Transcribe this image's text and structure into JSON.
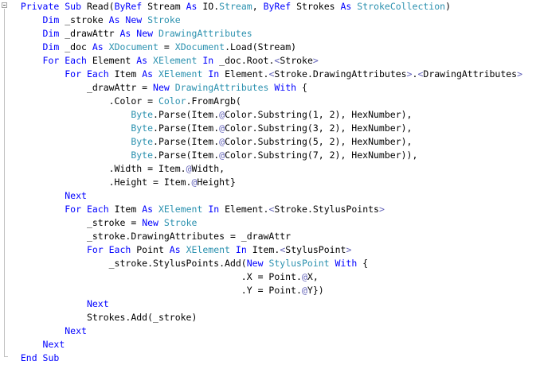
{
  "editor": {
    "language": "VB.NET",
    "colors": {
      "keyword": "#0000ff",
      "type": "#2b91af",
      "string_literal": "#a31515",
      "xml_bracket": "#6464b9",
      "plain": "#000000"
    },
    "lines": [
      {
        "indent": 2,
        "tokens": [
          [
            "kw",
            "Private Sub"
          ],
          [
            "p",
            " Read("
          ],
          [
            "kw",
            "ByRef"
          ],
          [
            "p",
            " Stream "
          ],
          [
            "kw",
            "As"
          ],
          [
            "p",
            " IO."
          ],
          [
            "ty",
            "Stream"
          ],
          [
            "p",
            ", "
          ],
          [
            "kw",
            "ByRef"
          ],
          [
            "p",
            " Strokes "
          ],
          [
            "kw",
            "As"
          ],
          [
            "p",
            " "
          ],
          [
            "ty",
            "StrokeCollection"
          ],
          [
            "p",
            ")"
          ]
        ]
      },
      {
        "indent": 6,
        "tokens": [
          [
            "kw",
            "Dim"
          ],
          [
            "p",
            " _stroke "
          ],
          [
            "kw",
            "As New"
          ],
          [
            "p",
            " "
          ],
          [
            "ty",
            "Stroke"
          ]
        ]
      },
      {
        "indent": 6,
        "tokens": [
          [
            "kw",
            "Dim"
          ],
          [
            "p",
            " _drawAttr "
          ],
          [
            "kw",
            "As New"
          ],
          [
            "p",
            " "
          ],
          [
            "ty",
            "DrawingAttributes"
          ]
        ]
      },
      {
        "indent": 6,
        "tokens": [
          [
            "kw",
            "Dim"
          ],
          [
            "p",
            " _doc "
          ],
          [
            "kw",
            "As"
          ],
          [
            "p",
            " "
          ],
          [
            "ty",
            "XDocument"
          ],
          [
            "p",
            " = "
          ],
          [
            "ty",
            "XDocument"
          ],
          [
            "p",
            ".Load(Stream)"
          ]
        ]
      },
      {
        "indent": 6,
        "tokens": [
          [
            "kw",
            "For Each"
          ],
          [
            "p",
            " Element "
          ],
          [
            "kw",
            "As"
          ],
          [
            "p",
            " "
          ],
          [
            "ty",
            "XElement"
          ],
          [
            "p",
            " "
          ],
          [
            "kw",
            "In"
          ],
          [
            "p",
            " _doc.Root."
          ],
          [
            "xb",
            "<"
          ],
          [
            "p",
            "Stroke"
          ],
          [
            "xb",
            ">"
          ]
        ]
      },
      {
        "indent": 10,
        "tokens": [
          [
            "kw",
            "For Each"
          ],
          [
            "p",
            " Item "
          ],
          [
            "kw",
            "As"
          ],
          [
            "p",
            " "
          ],
          [
            "ty",
            "XElement"
          ],
          [
            "p",
            " "
          ],
          [
            "kw",
            "In"
          ],
          [
            "p",
            " Element."
          ],
          [
            "xb",
            "<"
          ],
          [
            "p",
            "Stroke.DrawingAttributes"
          ],
          [
            "xb",
            ">"
          ],
          [
            "p",
            "."
          ],
          [
            "xb",
            "<"
          ],
          [
            "p",
            "DrawingAttributes"
          ],
          [
            "xb",
            ">"
          ]
        ]
      },
      {
        "indent": 14,
        "tokens": [
          [
            "p",
            "_drawAttr = "
          ],
          [
            "kw",
            "New"
          ],
          [
            "p",
            " "
          ],
          [
            "ty",
            "DrawingAttributes"
          ],
          [
            "p",
            " "
          ],
          [
            "kw",
            "With"
          ],
          [
            "p",
            " {"
          ]
        ]
      },
      {
        "indent": 18,
        "tokens": [
          [
            "p",
            ".Color = "
          ],
          [
            "ty",
            "Color"
          ],
          [
            "p",
            ".FromArgb("
          ]
        ]
      },
      {
        "indent": 22,
        "tokens": [
          [
            "ty",
            "Byte"
          ],
          [
            "p",
            ".Parse(Item."
          ],
          [
            "xb",
            "@"
          ],
          [
            "p",
            "Color.Substring(1, 2), HexNumber),"
          ]
        ]
      },
      {
        "indent": 22,
        "tokens": [
          [
            "ty",
            "Byte"
          ],
          [
            "p",
            ".Parse(Item."
          ],
          [
            "xb",
            "@"
          ],
          [
            "p",
            "Color.Substring(3, 2), HexNumber),"
          ]
        ]
      },
      {
        "indent": 22,
        "tokens": [
          [
            "ty",
            "Byte"
          ],
          [
            "p",
            ".Parse(Item."
          ],
          [
            "xb",
            "@"
          ],
          [
            "p",
            "Color.Substring(5, 2), HexNumber),"
          ]
        ]
      },
      {
        "indent": 22,
        "tokens": [
          [
            "ty",
            "Byte"
          ],
          [
            "p",
            ".Parse(Item."
          ],
          [
            "xb",
            "@"
          ],
          [
            "p",
            "Color.Substring(7, 2), HexNumber)),"
          ]
        ]
      },
      {
        "indent": 18,
        "tokens": [
          [
            "p",
            ".Width = Item."
          ],
          [
            "xb",
            "@"
          ],
          [
            "p",
            "Width,"
          ]
        ]
      },
      {
        "indent": 18,
        "tokens": [
          [
            "p",
            ".Height = Item."
          ],
          [
            "xb",
            "@"
          ],
          [
            "p",
            "Height}"
          ]
        ]
      },
      {
        "indent": 10,
        "tokens": [
          [
            "kw",
            "Next"
          ]
        ]
      },
      {
        "indent": 10,
        "tokens": [
          [
            "kw",
            "For Each"
          ],
          [
            "p",
            " Item "
          ],
          [
            "kw",
            "As"
          ],
          [
            "p",
            " "
          ],
          [
            "ty",
            "XElement"
          ],
          [
            "p",
            " "
          ],
          [
            "kw",
            "In"
          ],
          [
            "p",
            " Element."
          ],
          [
            "xb",
            "<"
          ],
          [
            "p",
            "Stroke.StylusPoints"
          ],
          [
            "xb",
            ">"
          ]
        ]
      },
      {
        "indent": 14,
        "tokens": [
          [
            "p",
            "_stroke = "
          ],
          [
            "kw",
            "New"
          ],
          [
            "p",
            " "
          ],
          [
            "ty",
            "Stroke"
          ]
        ]
      },
      {
        "indent": 14,
        "tokens": [
          [
            "p",
            "_stroke.DrawingAttributes = _drawAttr"
          ]
        ]
      },
      {
        "indent": 14,
        "tokens": [
          [
            "kw",
            "For Each"
          ],
          [
            "p",
            " Point "
          ],
          [
            "kw",
            "As"
          ],
          [
            "p",
            " "
          ],
          [
            "ty",
            "XElement"
          ],
          [
            "p",
            " "
          ],
          [
            "kw",
            "In"
          ],
          [
            "p",
            " Item."
          ],
          [
            "xb",
            "<"
          ],
          [
            "p",
            "StylusPoint"
          ],
          [
            "xb",
            ">"
          ]
        ]
      },
      {
        "indent": 18,
        "tokens": [
          [
            "p",
            "_stroke.StylusPoints.Add("
          ],
          [
            "kw",
            "New"
          ],
          [
            "p",
            " "
          ],
          [
            "ty",
            "StylusPoint"
          ],
          [
            "p",
            " "
          ],
          [
            "kw",
            "With"
          ],
          [
            "p",
            " {"
          ]
        ]
      },
      {
        "indent": 42,
        "tokens": [
          [
            "p",
            ".X = Point."
          ],
          [
            "xb",
            "@"
          ],
          [
            "p",
            "X,"
          ]
        ]
      },
      {
        "indent": 42,
        "tokens": [
          [
            "p",
            ".Y = Point."
          ],
          [
            "xb",
            "@"
          ],
          [
            "p",
            "Y})"
          ]
        ]
      },
      {
        "indent": 14,
        "tokens": [
          [
            "kw",
            "Next"
          ]
        ]
      },
      {
        "indent": 14,
        "tokens": [
          [
            "p",
            "Strokes.Add(_stroke)"
          ]
        ]
      },
      {
        "indent": 10,
        "tokens": [
          [
            "kw",
            "Next"
          ]
        ]
      },
      {
        "indent": 6,
        "tokens": [
          [
            "kw",
            "Next"
          ]
        ]
      },
      {
        "indent": 2,
        "tokens": [
          [
            "kw",
            "End Sub"
          ]
        ]
      }
    ]
  }
}
